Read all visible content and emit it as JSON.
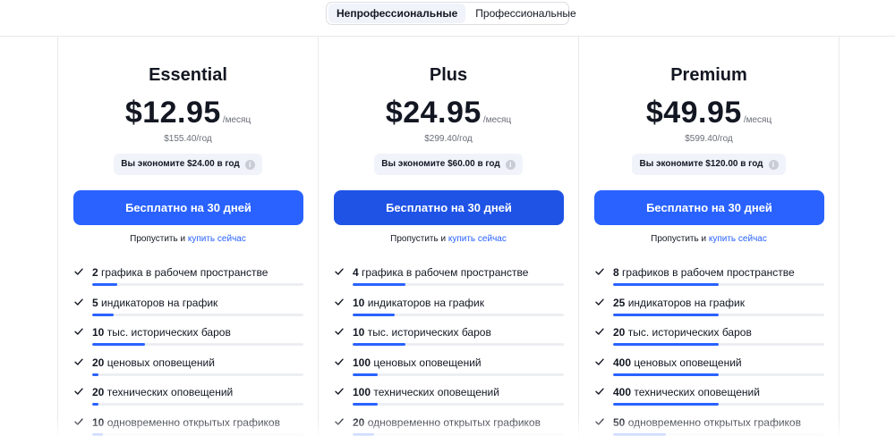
{
  "toggle": {
    "options": [
      "Непрофессиональные",
      "Профессиональные"
    ],
    "selected": 0
  },
  "colors": {
    "accent": "#2962ff",
    "pill_bg": "#f0f3fa",
    "track": "#eceef2"
  },
  "icons": {
    "feature": "check-icon",
    "save": "info-icon"
  },
  "plans": [
    {
      "name": "Essential",
      "price": "$12.95",
      "per": "/месяц",
      "yearly": "$155.40/год",
      "save": "Вы экономите $24.00 в год",
      "cta": "Бесплатно на 30 дней",
      "skip_text": "Пропустить и",
      "skip_link": "купить сейчас",
      "features": [
        {
          "value": "2",
          "label": "графика в рабочем пространстве",
          "level": 0.12
        },
        {
          "value": "5",
          "label": "индикаторов на график",
          "level": 0.1
        },
        {
          "value": "10",
          "label": "тыс. исторических баров",
          "level": 0.25
        },
        {
          "value": "20",
          "label": "ценовых оповещений",
          "level": 0.03
        },
        {
          "value": "20",
          "label": "технических оповещений",
          "level": 0.03
        },
        {
          "value": "10",
          "label": "одновременно открытых графиков",
          "level": 0.05
        }
      ]
    },
    {
      "name": "Plus",
      "price": "$24.95",
      "per": "/месяц",
      "yearly": "$299.40/год",
      "save": "Вы экономите $60.00 в год",
      "cta": "Бесплатно на 30 дней",
      "skip_text": "Пропустить и",
      "skip_link": "купить сейчас",
      "features": [
        {
          "value": "4",
          "label": "графика в рабочем пространстве",
          "level": 0.25
        },
        {
          "value": "10",
          "label": "индикаторов на график",
          "level": 0.2
        },
        {
          "value": "10",
          "label": "тыс. исторических баров",
          "level": 0.25
        },
        {
          "value": "100",
          "label": "ценовых оповещений",
          "level": 0.12
        },
        {
          "value": "100",
          "label": "технических оповещений",
          "level": 0.12
        },
        {
          "value": "20",
          "label": "одновременно открытых графиков",
          "level": 0.1
        }
      ]
    },
    {
      "name": "Premium",
      "price": "$49.95",
      "per": "/месяц",
      "yearly": "$599.40/год",
      "save": "Вы экономите $120.00 в год",
      "cta": "Бесплатно на 30 дней",
      "skip_text": "Пропустить и",
      "skip_link": "купить сейчас",
      "features": [
        {
          "value": "8",
          "label": "графиков в рабочем пространстве",
          "level": 0.5
        },
        {
          "value": "25",
          "label": "индикаторов на график",
          "level": 0.5
        },
        {
          "value": "20",
          "label": "тыс. исторических баров",
          "level": 0.5
        },
        {
          "value": "400",
          "label": "ценовых оповещений",
          "level": 0.5
        },
        {
          "value": "400",
          "label": "технических оповещений",
          "level": 0.5
        },
        {
          "value": "50",
          "label": "одновременно открытых графиков",
          "level": 0.25
        }
      ]
    }
  ]
}
